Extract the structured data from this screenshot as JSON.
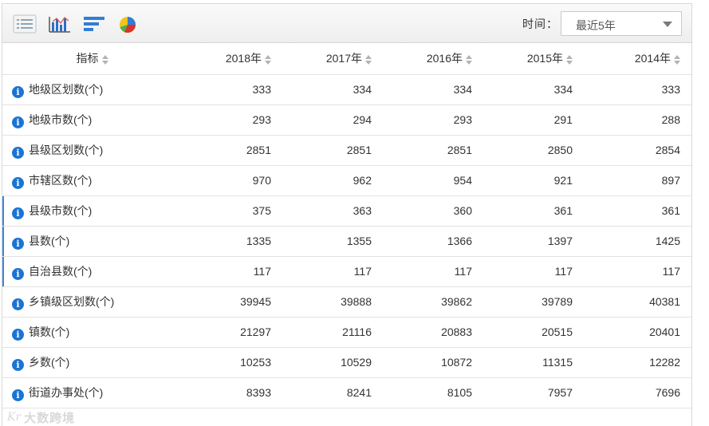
{
  "toolbar": {
    "icons": [
      "table-view-icon",
      "bar-chart-icon",
      "horizontal-bar-chart-icon",
      "pie-chart-icon"
    ],
    "time_label": "时间：",
    "time_value": "最近5年"
  },
  "table": {
    "header_indicator": "指标",
    "years": [
      "2018年",
      "2017年",
      "2016年",
      "2015年",
      "2014年"
    ],
    "rows": [
      {
        "name": "地级区划数(个)",
        "values": [
          "333",
          "334",
          "334",
          "334",
          "333"
        ]
      },
      {
        "name": "地级市数(个)",
        "values": [
          "293",
          "294",
          "293",
          "291",
          "288"
        ]
      },
      {
        "name": "县级区划数(个)",
        "values": [
          "2851",
          "2851",
          "2851",
          "2850",
          "2854"
        ]
      },
      {
        "name": "市辖区数(个)",
        "values": [
          "970",
          "962",
          "954",
          "921",
          "897"
        ]
      },
      {
        "name": "县级市数(个)",
        "values": [
          "375",
          "363",
          "360",
          "361",
          "361"
        ]
      },
      {
        "name": "县数(个)",
        "values": [
          "1335",
          "1355",
          "1366",
          "1397",
          "1425"
        ]
      },
      {
        "name": "自治县数(个)",
        "values": [
          "117",
          "117",
          "117",
          "117",
          "117"
        ]
      },
      {
        "name": "乡镇级区划数(个)",
        "values": [
          "39945",
          "39888",
          "39862",
          "39789",
          "40381"
        ]
      },
      {
        "name": "镇数(个)",
        "values": [
          "21297",
          "21116",
          "20883",
          "20515",
          "20401"
        ]
      },
      {
        "name": "乡数(个)",
        "values": [
          "10253",
          "10529",
          "10872",
          "11315",
          "12282"
        ]
      },
      {
        "name": "街道办事处(个)",
        "values": [
          "8393",
          "8241",
          "8105",
          "7957",
          "7696"
        ]
      }
    ]
  },
  "watermark": {
    "logo": "Kr",
    "text": "大数跨境"
  },
  "colors": {
    "info_icon": "#1a74d4",
    "border": "#e2e2e2",
    "toolbar_bg": "#eeeeee"
  }
}
